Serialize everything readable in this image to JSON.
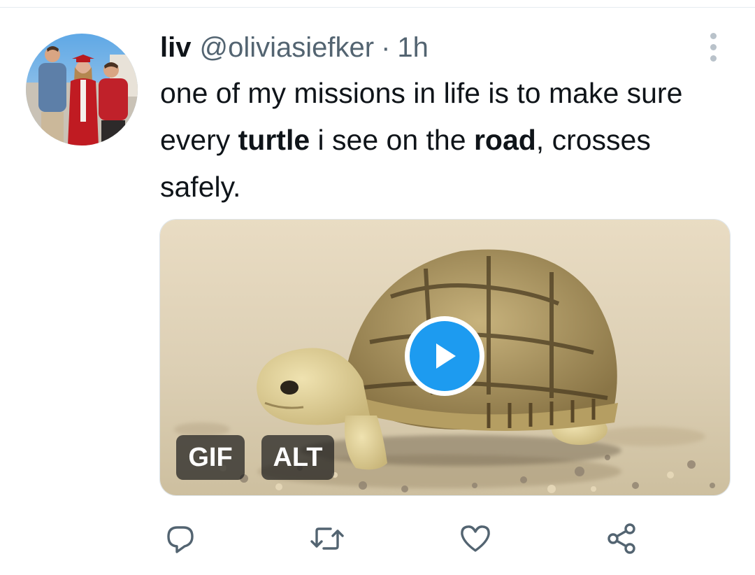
{
  "tweet": {
    "display_name": "liv",
    "handle": "@oliviasiefker",
    "separator": "·",
    "timestamp": "1h",
    "text_segments": [
      "one of my missions in life is to make sure every ",
      "turtle",
      " i see on the ",
      "road",
      ", crosses safely."
    ],
    "bold_words": [
      "turtle",
      "road"
    ]
  },
  "media": {
    "type": "gif",
    "gif_badge": "GIF",
    "alt_badge": "ALT",
    "play_icon": "play-icon",
    "accent": "#1d9bf0"
  },
  "actions": {
    "icons": [
      "reply-icon",
      "retweet-icon",
      "like-icon",
      "share-icon"
    ]
  },
  "colors": {
    "text": "#0f1419",
    "secondary": "#536471",
    "icon": "#536471"
  }
}
